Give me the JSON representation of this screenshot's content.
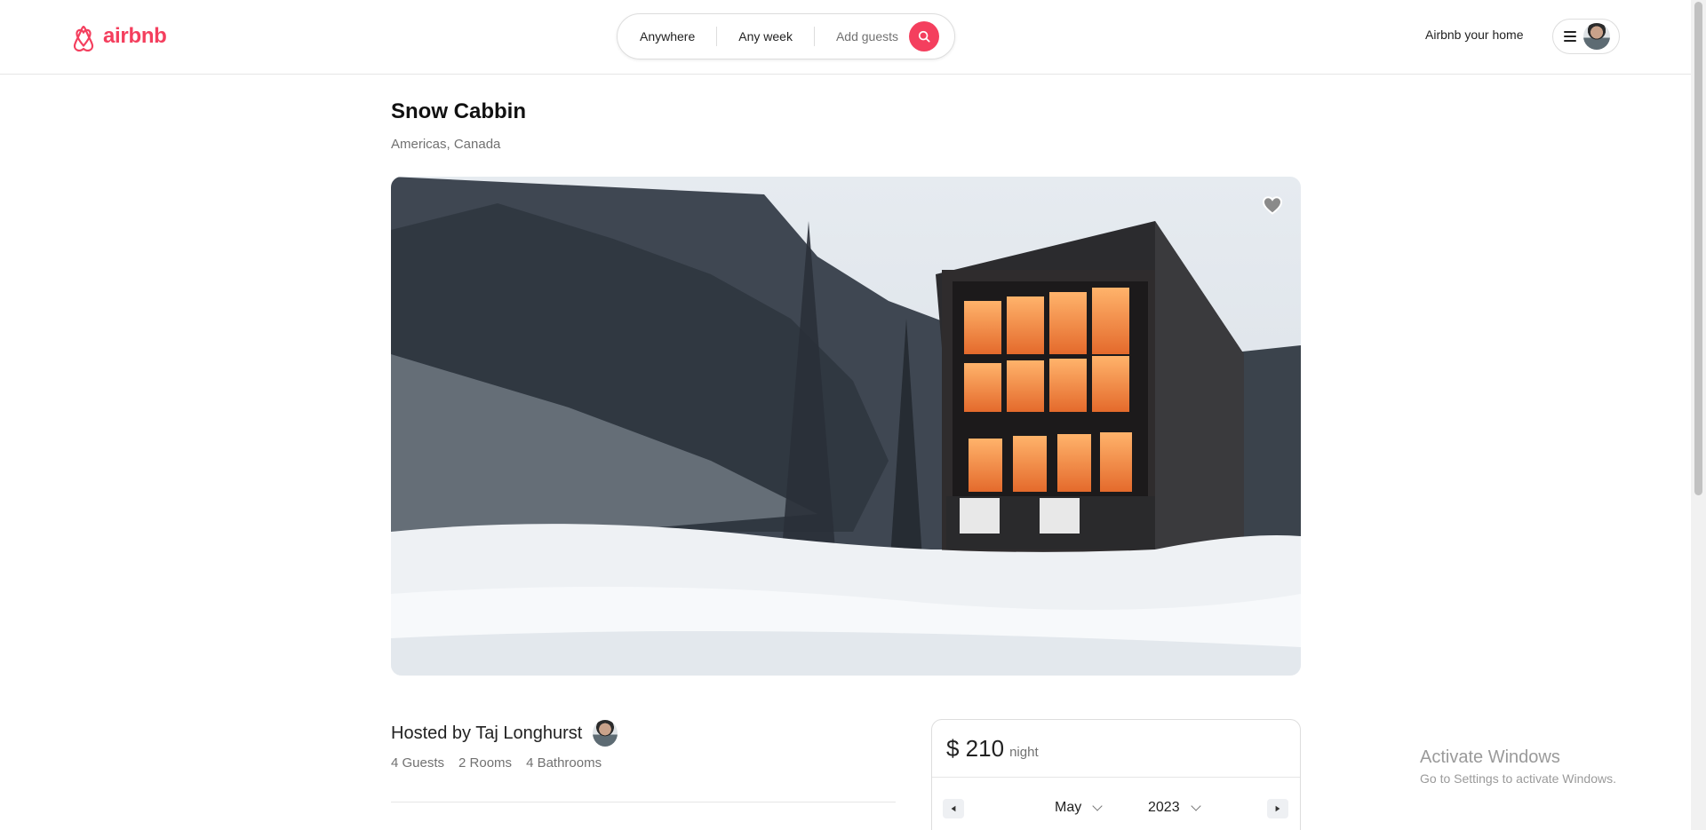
{
  "header": {
    "logo_text": "airbnb",
    "brand_color": "#f43f5e",
    "search": {
      "location": "Anywhere",
      "dates": "Any week",
      "guests": "Add guests"
    },
    "host_link": "Airbnb your home"
  },
  "listing": {
    "title": "Snow Cabbin",
    "location": "Americas, Canada",
    "host": "Hosted by Taj Longhurst",
    "stats": [
      "4 Guests",
      "2 Rooms",
      "4 Bathrooms"
    ]
  },
  "booking": {
    "price": "$ 210",
    "unit": "night",
    "calendar": {
      "month": "May",
      "year": "2023"
    }
  },
  "overlay": {
    "title": "Activate Windows",
    "subtitle": "Go to Settings to activate Windows."
  }
}
